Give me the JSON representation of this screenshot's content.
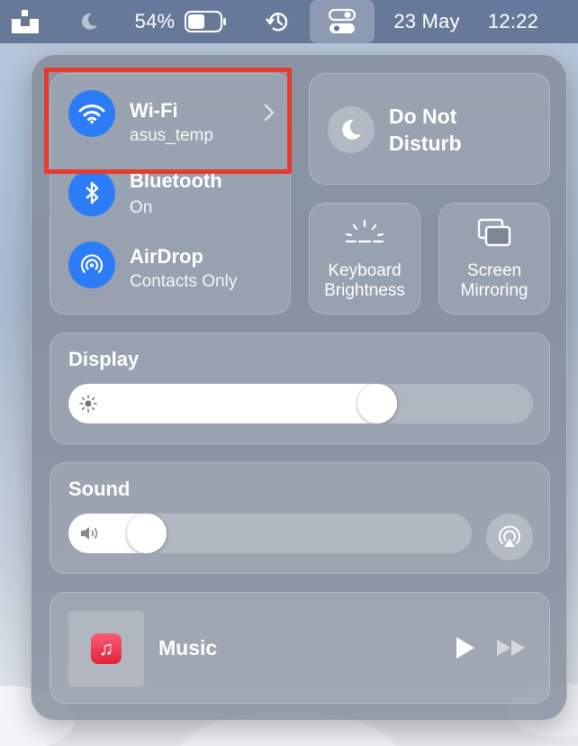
{
  "menubar": {
    "battery_percent": "54%",
    "battery_level": 0.54,
    "date": "23 May",
    "time": "12:22"
  },
  "connectivity": {
    "wifi": {
      "title": "Wi-Fi",
      "subtitle": "asus_temp"
    },
    "bluetooth": {
      "title": "Bluetooth",
      "subtitle": "On"
    },
    "airdrop": {
      "title": "AirDrop",
      "subtitle": "Contacts Only"
    }
  },
  "do_not_disturb": {
    "line1": "Do Not",
    "line2": "Disturb"
  },
  "keyboard_brightness": {
    "line1": "Keyboard",
    "line2": "Brightness"
  },
  "screen_mirroring": {
    "line1": "Screen",
    "line2": "Mirroring"
  },
  "display": {
    "title": "Display",
    "level": 0.68
  },
  "sound": {
    "title": "Sound",
    "level": 0.16
  },
  "music": {
    "title": "Music"
  },
  "colors": {
    "accent_blue": "#2b7cf6",
    "highlight_red": "#e8392a",
    "menubar": "#607294"
  }
}
